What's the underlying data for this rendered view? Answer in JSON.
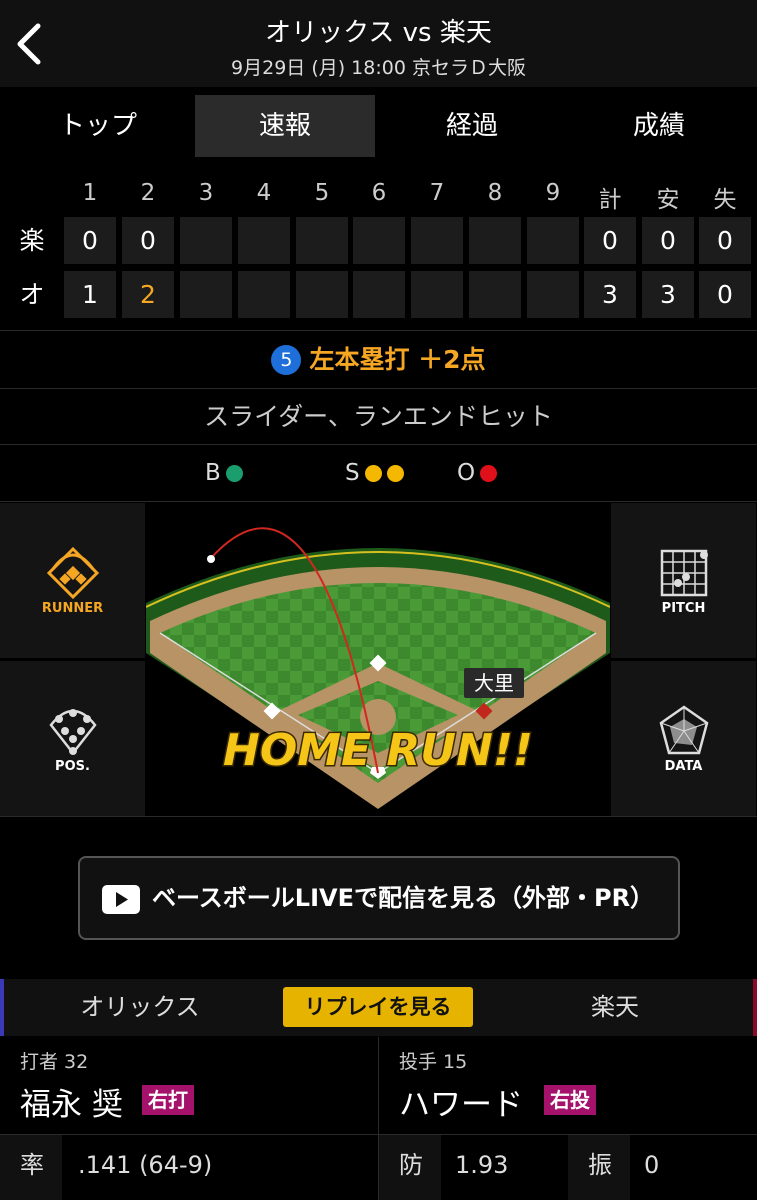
{
  "header": {
    "title": "オリックス vs 楽天",
    "subtitle": "9月29日 (月) 18:00 京セラＤ大阪"
  },
  "tabs": [
    {
      "label": "トップ",
      "active": false
    },
    {
      "label": "速報",
      "active": true
    },
    {
      "label": "経過",
      "active": false
    },
    {
      "label": "成績",
      "active": false
    }
  ],
  "scoreboard": {
    "headers": [
      "1",
      "2",
      "3",
      "4",
      "5",
      "6",
      "7",
      "8",
      "9",
      "計",
      "安",
      "失"
    ],
    "rows": [
      {
        "team": "楽",
        "innings": [
          "0",
          "0",
          "",
          "",
          "",
          "",
          "",
          "",
          ""
        ],
        "totals": [
          "0",
          "0",
          "0"
        ]
      },
      {
        "team": "オ",
        "innings": [
          "1",
          "2",
          "",
          "",
          "",
          "",
          "",
          "",
          ""
        ],
        "totals": [
          "3",
          "3",
          "0"
        ]
      }
    ],
    "highlight_color": "#f5a623"
  },
  "play": {
    "number": "5",
    "text": "左本塁打 ＋2点"
  },
  "pitch_desc": "スライダー、ランエンドヒット",
  "count": {
    "b_label": "B",
    "s_label": "S",
    "o_label": "O",
    "balls": 1,
    "strikes": 2,
    "outs": 1,
    "colors": {
      "ball": "#1a9e6e",
      "strike": "#f5b800",
      "out": "#e0101a"
    }
  },
  "field": {
    "runner_label": "RUNNER",
    "pos_label": "POS.",
    "pitch_label": "PITCH",
    "data_label": "DATA",
    "player_tag": "大里",
    "event_text": "HOME RUN!!"
  },
  "live_button": {
    "label": "ベースボールLIVEで配信を見る（外部・PR）"
  },
  "team_bar": {
    "home": "オリックス",
    "replay": "リプレイを見る",
    "away": "楽天"
  },
  "batter": {
    "caption": "打者 32",
    "name": "福永 奨",
    "badge": "右打",
    "stat_label": "率",
    "stat_value": ".141 (64-9)"
  },
  "pitcher": {
    "caption": "投手 15",
    "name": "ハワード",
    "badge": "右投",
    "stat_label": "防",
    "stat_value": "1.93",
    "stat2_label": "振",
    "stat2_value": "0"
  }
}
